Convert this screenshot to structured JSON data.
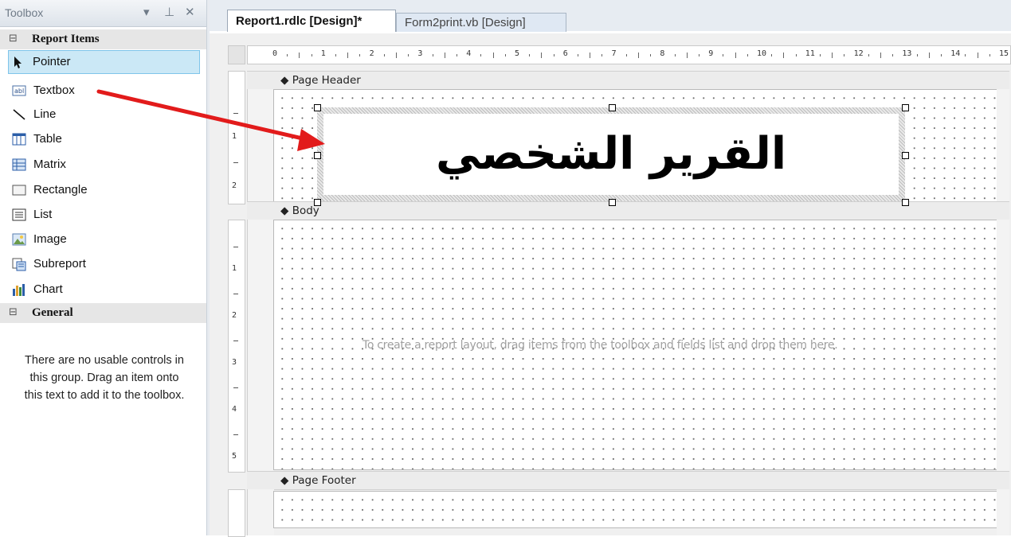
{
  "toolbox": {
    "title": "Toolbox",
    "buttons": {
      "dropdown": "▾",
      "pin": "⊥",
      "close": "✕"
    },
    "categories": [
      {
        "label": "Report Items",
        "expander": "⊟"
      },
      {
        "label": "General",
        "expander": "⊟"
      }
    ],
    "items": [
      {
        "label": "Pointer",
        "icon": "pointer-icon",
        "selected": true
      },
      {
        "label": "Textbox",
        "icon": "textbox-icon"
      },
      {
        "label": "Line",
        "icon": "line-icon"
      },
      {
        "label": "Table",
        "icon": "table-icon"
      },
      {
        "label": "Matrix",
        "icon": "matrix-icon"
      },
      {
        "label": "Rectangle",
        "icon": "rectangle-icon"
      },
      {
        "label": "List",
        "icon": "list-icon"
      },
      {
        "label": "Image",
        "icon": "image-icon"
      },
      {
        "label": "Subreport",
        "icon": "subreport-icon"
      },
      {
        "label": "Chart",
        "icon": "chart-icon"
      }
    ],
    "general_empty_text": "There are no usable controls in this group. Drag an item onto this text to add it to the toolbox."
  },
  "tabs": [
    {
      "label": "Report1.rdlc [Design]*",
      "active": true
    },
    {
      "label": "Form2print.vb [Design]",
      "active": false
    }
  ],
  "ruler": {
    "horizontal": [
      "0",
      "1",
      "2",
      "3",
      "4",
      "5",
      "6",
      "7",
      "8",
      "9",
      "10",
      "11",
      "12",
      "13",
      "14",
      "15"
    ],
    "header_vertical": [
      "1",
      "2"
    ],
    "body_vertical": [
      "1",
      "2",
      "3",
      "4",
      "5"
    ]
  },
  "sections": {
    "page_header": "Page Header",
    "body": "Body",
    "page_footer": "Page Footer"
  },
  "report_title": "القرير الشخصي",
  "body_hint": "To create a report layout, drag items from the toolbox and fields list and drop them here.",
  "colors": {
    "arrow": "#e21b1b",
    "selection": "#cbe8f6"
  }
}
